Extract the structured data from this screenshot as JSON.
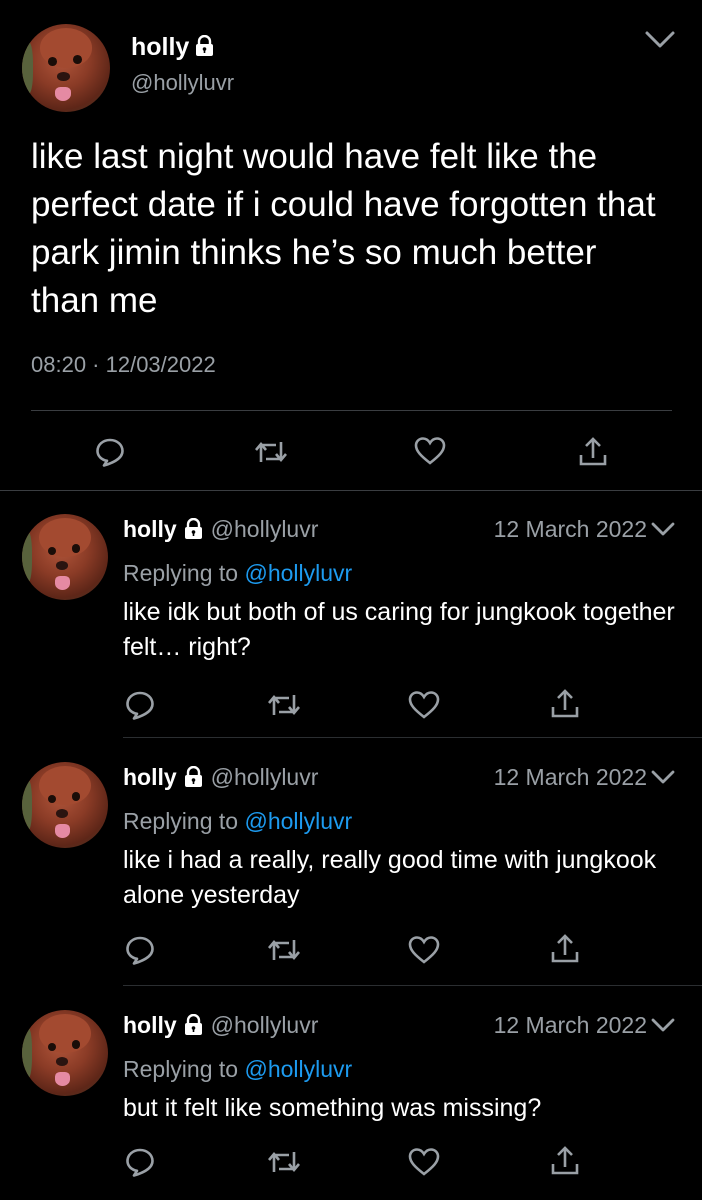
{
  "main_tweet": {
    "name": "holly",
    "handle": "@hollyluvr",
    "text": "like last night would have felt like the perfect date if i could have forgotten that park jimin thinks he’s so much better than me",
    "timestamp": "08:20 · 12/03/2022",
    "icons": {
      "menu": "chevron-down-icon",
      "lock": "lock-icon"
    }
  },
  "replies": [
    {
      "name": "holly",
      "handle": "@hollyluvr",
      "date": "12 March 2022",
      "replying_prefix": "Replying to",
      "replying_to": "@hollyluvr",
      "text": "like idk but both of us caring for jungkook together felt… right?"
    },
    {
      "name": "holly",
      "handle": "@hollyluvr",
      "date": "12 March 2022",
      "replying_prefix": "Replying to",
      "replying_to": "@hollyluvr",
      "text": "like i had a really, really good time with jungkook alone yesterday"
    },
    {
      "name": "holly",
      "handle": "@hollyluvr",
      "date": "12 March 2022",
      "replying_prefix": "Replying to",
      "replying_to": "@hollyluvr",
      "text": "but it felt like something was missing?"
    }
  ],
  "action_icons": [
    "reply-icon",
    "retweet-icon",
    "like-icon",
    "share-icon"
  ],
  "colors": {
    "background": "#000000",
    "text": "#ffffff",
    "muted": "#9aa0a6",
    "link": "#1d9bf0",
    "divider": "#3a3d41"
  }
}
